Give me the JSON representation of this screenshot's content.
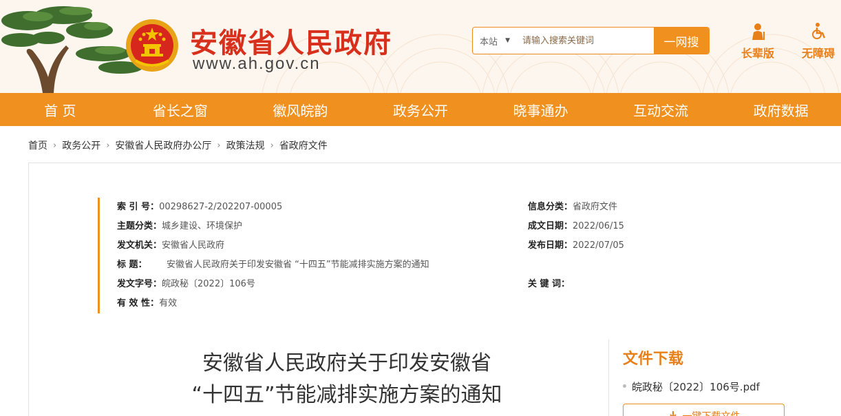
{
  "header": {
    "title": "安徽省人民政府",
    "url": "www.ah.gov.cn",
    "search": {
      "scope": "本站",
      "placeholder": "请输入搜索关键词",
      "value": "",
      "button_label": "一网搜"
    },
    "tools": {
      "elder": "长辈版",
      "accessible": "无障碍"
    }
  },
  "nav": {
    "items": [
      "首 页",
      "省长之窗",
      "徽风皖韵",
      "政务公开",
      "晓事通办",
      "互动交流",
      "政府数据"
    ]
  },
  "breadcrumb": [
    "首页",
    "政务公开",
    "安徽省人民政府办公厅",
    "政策法规",
    "省政府文件"
  ],
  "meta": {
    "index_no_label": "索 引 号：",
    "index_no": "00298627-2/202207-00005",
    "category_label": "信息分类：",
    "category": "省政府文件",
    "topic_label": "主题分类：",
    "topic": "城乡建设、环境保护",
    "created_label": "成文日期：",
    "created": "2022/06/15",
    "issuer_label": "发文机关：",
    "issuer": "安徽省人民政府",
    "published_label": "发布日期：",
    "published": "2022/07/05",
    "title_label": "标 题：",
    "title": "安徽省人民政府关于印发安徽省 “十四五”节能减排实施方案的通知",
    "doc_no_label": "发文字号：",
    "doc_no": "皖政秘〔2022〕106号",
    "keywords_label": "关 键 词：",
    "keywords": "",
    "validity_label": "有 效 性：",
    "validity": "有效"
  },
  "document": {
    "title_line1": "安徽省人民政府关于印发安徽省",
    "title_line2": "“十四五”节能减排实施方案的通知"
  },
  "downloads": {
    "heading": "文件下载",
    "items": [
      "皖政秘〔2022〕106号.pdf"
    ],
    "button_label": "一键下载文件"
  },
  "colors": {
    "brand_orange": "#f0901e",
    "title_red": "#d7301c"
  }
}
